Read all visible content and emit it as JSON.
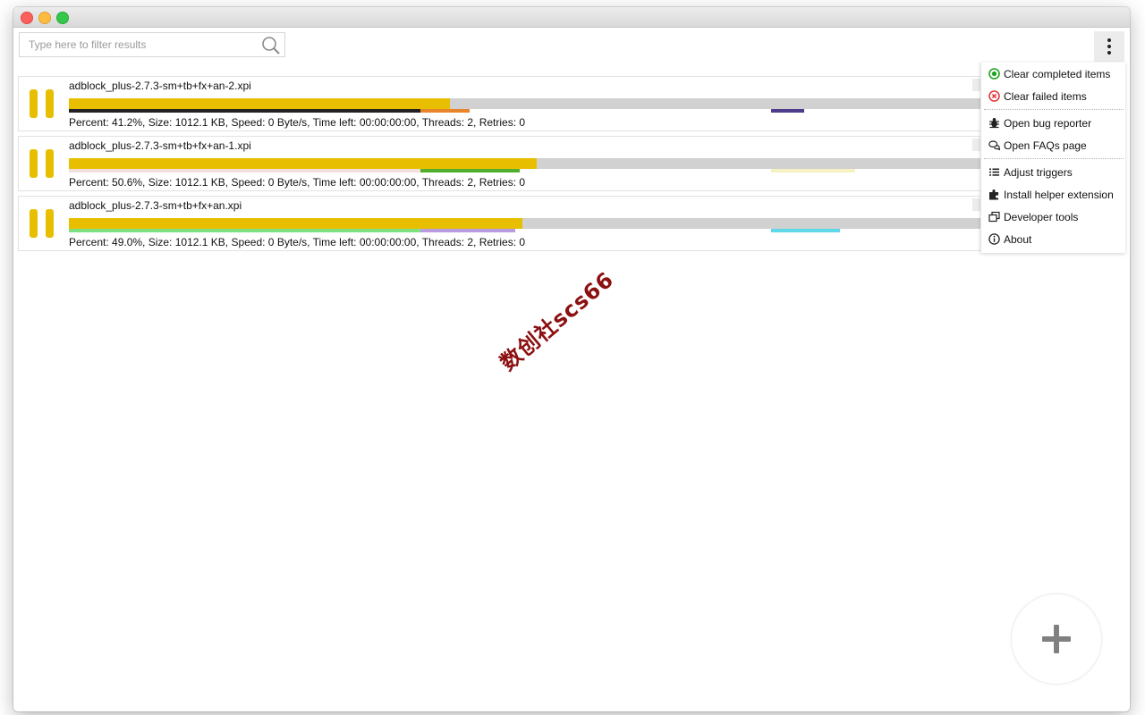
{
  "window": {
    "title": ""
  },
  "search": {
    "placeholder": "Type here to filter results",
    "value": ""
  },
  "downloads": [
    {
      "filename": "adblock_plus-2.7.3-sm+tb+fx+an-2.xpi",
      "percent": 41.2,
      "info": "Percent: 41.2%, Size: 1012.1 KB, Speed: 0 Byte/s, Time left: 00:00:00:00, Threads: 2, Retries: 0",
      "threads": [
        {
          "start": 0.0,
          "end": 0.38,
          "color": "#222222"
        },
        {
          "start": 0.38,
          "end": 0.433,
          "color": "#e8842c"
        },
        {
          "start": 0.759,
          "end": 0.795,
          "color": "#4d3b8c"
        }
      ]
    },
    {
      "filename": "adblock_plus-2.7.3-sm+tb+fx+an-1.xpi",
      "percent": 50.6,
      "info": "Percent: 50.6%, Size: 1012.1 KB, Speed: 0 Byte/s, Time left: 00:00:00:00, Threads: 2, Retries: 0",
      "threads": [
        {
          "start": 0.0,
          "end": 0.38,
          "color": "#f4dede"
        },
        {
          "start": 0.38,
          "end": 0.487,
          "color": "#4fae2c"
        },
        {
          "start": 0.759,
          "end": 0.85,
          "color": "#f7f2c4"
        }
      ]
    },
    {
      "filename": "adblock_plus-2.7.3-sm+tb+fx+an.xpi",
      "percent": 49.0,
      "info": "Percent: 49.0%, Size: 1012.1 KB, Speed: 0 Byte/s, Time left: 00:00:00:00, Threads: 2, Retries: 0",
      "threads": [
        {
          "start": 0.0,
          "end": 0.38,
          "color": "#7fe07f"
        },
        {
          "start": 0.38,
          "end": 0.483,
          "color": "#b99be0"
        },
        {
          "start": 0.759,
          "end": 0.834,
          "color": "#5fd8e8"
        }
      ]
    }
  ],
  "menu": {
    "items": [
      {
        "label": "Clear completed items",
        "icon": "check-circle-icon"
      },
      {
        "label": "Clear failed items",
        "icon": "x-circle-icon"
      },
      {
        "label": "Open bug reporter",
        "icon": "bug-icon"
      },
      {
        "label": "Open FAQs page",
        "icon": "chat-bubbles-icon"
      },
      {
        "label": "Adjust triggers",
        "icon": "list-icon"
      },
      {
        "label": "Install helper extension",
        "icon": "puzzle-icon"
      },
      {
        "label": "Developer tools",
        "icon": "copy-window-icon"
      },
      {
        "label": "About",
        "icon": "info-circle-icon"
      }
    ]
  },
  "watermark": "数创社scs66",
  "colors": {
    "progress_fill": "#e8bf00",
    "progress_track": "#d1d1d1",
    "success": "#1fa31f",
    "failure": "#e03b3b"
  }
}
